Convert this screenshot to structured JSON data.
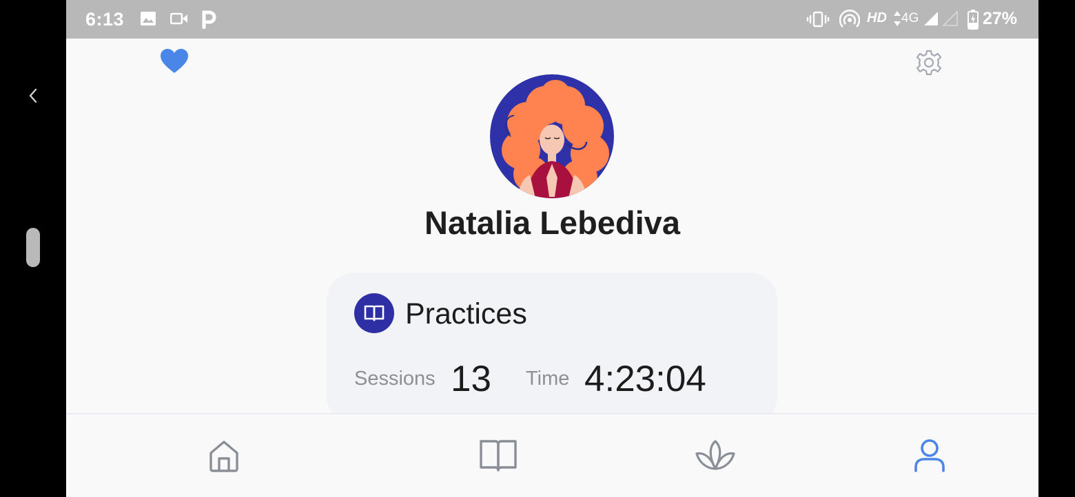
{
  "status_bar": {
    "time": "6:13",
    "network_label": "HD",
    "network_type": "4G",
    "battery": "27%"
  },
  "profile": {
    "name": "Natalia Lebediva"
  },
  "practices": {
    "title": "Practices",
    "sessions_label": "Sessions",
    "sessions_value": "13",
    "time_label": "Time",
    "time_value": "4:23:04"
  },
  "colors": {
    "accent": "#4a86e8",
    "badge": "#2e2fa5",
    "nav_inactive": "#8a8e96"
  },
  "bottom_nav": {
    "items": [
      {
        "icon": "home-icon",
        "active": false
      },
      {
        "icon": "book-icon",
        "active": false
      },
      {
        "icon": "lotus-icon",
        "active": false
      },
      {
        "icon": "profile-icon",
        "active": true
      }
    ]
  }
}
